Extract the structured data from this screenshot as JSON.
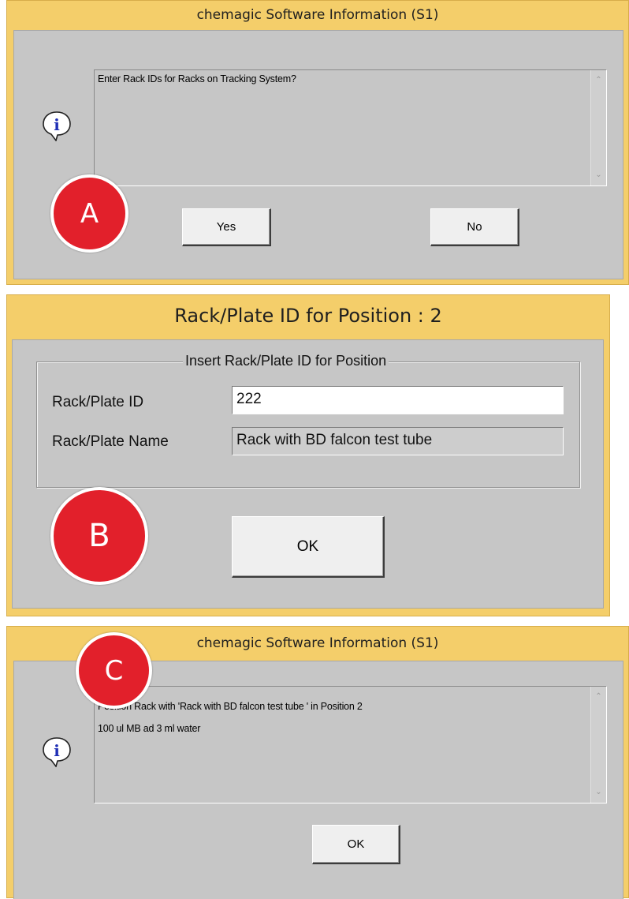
{
  "dialog_a": {
    "title": "chemagic Software Information (S1)",
    "message": "Enter Rack IDs for Racks on Tracking System?",
    "yes_label": "Yes",
    "no_label": "No",
    "badge": "A",
    "icon": "info-icon"
  },
  "dialog_b": {
    "title": "Rack/Plate ID for Position : 2",
    "group_title": "Insert Rack/Plate ID for Position",
    "rack_id_label": "Rack/Plate ID",
    "rack_id_value": "222",
    "rack_name_label": "Rack/Plate Name",
    "rack_name_value": "Rack with BD falcon test tube",
    "ok_label": "OK",
    "badge": "B"
  },
  "dialog_c": {
    "title": "chemagic Software Information (S1)",
    "message_line1": "Position Rack with 'Rack with BD falcon test tube ' in Position 2",
    "message_line2": "100 ul MB ad 3 ml water",
    "ok_label": "OK",
    "badge": "C",
    "icon": "info-icon"
  },
  "colors": {
    "frame": "#f4ce6a",
    "client": "#c6c6c6",
    "badge": "#e2202b",
    "info_icon_blue": "#1f2fb5"
  }
}
